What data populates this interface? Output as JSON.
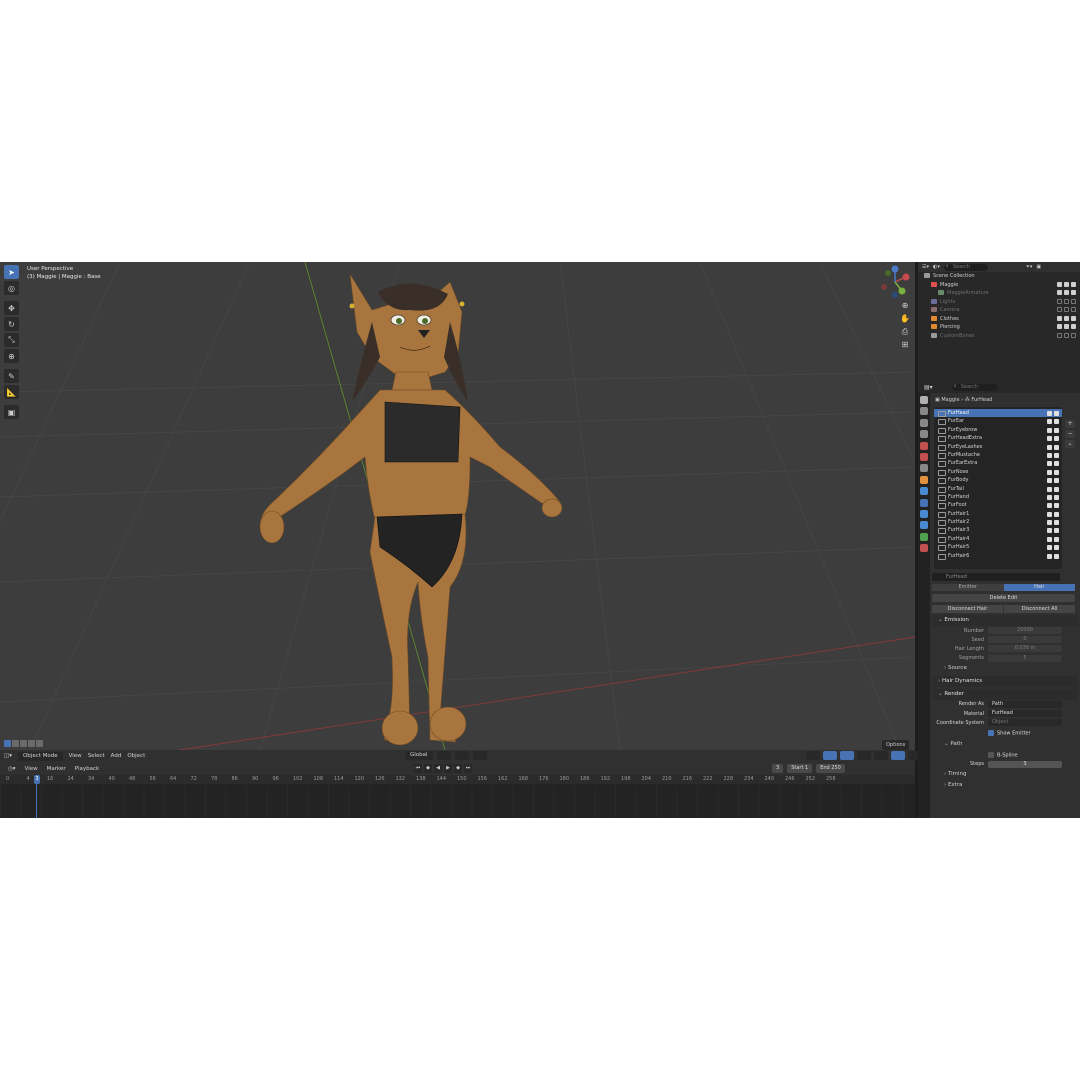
{
  "viewport": {
    "view_name": "User Perspective",
    "context": "(3) Maggie | Maggie : Base",
    "options_label": "Options"
  },
  "header": {
    "mode": "Object Mode",
    "menus": [
      "View",
      "Select",
      "Add",
      "Object"
    ],
    "orientation": "Global"
  },
  "timeline": {
    "menus": [
      "View",
      "Marker",
      "Playback"
    ],
    "current_frame": "3",
    "start_label": "Start",
    "start_value": "1",
    "end_label": "End",
    "end_value": "250",
    "ruler": [
      "0",
      "4",
      "16",
      "24",
      "34",
      "40",
      "48",
      "56",
      "64",
      "72",
      "78",
      "86",
      "90",
      "96",
      "102",
      "108",
      "114",
      "120",
      "126",
      "132",
      "138",
      "144",
      "150",
      "156",
      "162",
      "168",
      "176",
      "180",
      "186",
      "192",
      "198",
      "204",
      "210",
      "216",
      "222",
      "228",
      "234",
      "240",
      "246",
      "252",
      "258"
    ],
    "playhead": "3"
  },
  "outliner": {
    "search_placeholder": "Search",
    "rows": [
      {
        "label": "Scene Collection",
        "dim": false,
        "indent": 0,
        "color": "#9a9a9a",
        "vis": false
      },
      {
        "label": "Maggie",
        "dim": false,
        "indent": 1,
        "color": "#e05050",
        "vis": true
      },
      {
        "label": "MaggieArmature",
        "dim": true,
        "indent": 2,
        "color": "#6c8a6c",
        "vis": true
      },
      {
        "label": "Lights",
        "dim": true,
        "indent": 1,
        "color": "#6c6c9a",
        "vis": false
      },
      {
        "label": "Camera",
        "dim": true,
        "indent": 1,
        "color": "#8a6c6c",
        "vis": false
      },
      {
        "label": "Clothes",
        "dim": false,
        "indent": 1,
        "color": "#e08a30",
        "vis": true
      },
      {
        "label": "Piercing",
        "dim": false,
        "indent": 1,
        "color": "#e08a30",
        "vis": true
      },
      {
        "label": "CustomBones",
        "dim": true,
        "indent": 1,
        "color": "#9a9a9a",
        "vis": false
      }
    ]
  },
  "properties": {
    "search_placeholder": "Search",
    "breadcrumb": [
      "Maggie",
      "FurHead"
    ],
    "particle_systems": [
      "FurHead",
      "FurEar",
      "FurEyebrow",
      "FurHeadExtra",
      "FurEyeLashes",
      "FurMustache",
      "FurEarExtra",
      "FurNose",
      "FurBody",
      "FurTail",
      "FurHand",
      "FurFoot",
      "FurHair1",
      "FurHair2",
      "FurHair3",
      "FurHair4",
      "FurHair5",
      "FurHair6"
    ],
    "selected_system": "FurHead",
    "settings_name": "FurHead",
    "type_toggle": [
      "Emitter",
      "Hair"
    ],
    "delete_edit": "Delete Edit",
    "disconnect_hair": "Disconnect Hair",
    "disconnect_all": "Disconnect All",
    "emission": {
      "title": "Emission",
      "number_label": "Number",
      "number_value": "20000",
      "seed_label": "Seed",
      "seed_value": "0",
      "hair_length_label": "Hair Length",
      "hair_length_value": "0.036 m",
      "segments_label": "Segments",
      "segments_value": "5",
      "source": "Source"
    },
    "hair_dynamics": "Hair Dynamics",
    "render": {
      "title": "Render",
      "render_as_label": "Render As",
      "render_as_value": "Path",
      "material_label": "Material",
      "material_value": "FurHead",
      "coord_label": "Coordinate System",
      "coord_placeholder": "Object",
      "show_emitter": "Show Emitter",
      "path": "Path",
      "bspline": "B-Spline",
      "steps_label": "Steps",
      "steps_value": "3",
      "timing": "Timing",
      "extra": "Extra"
    }
  }
}
